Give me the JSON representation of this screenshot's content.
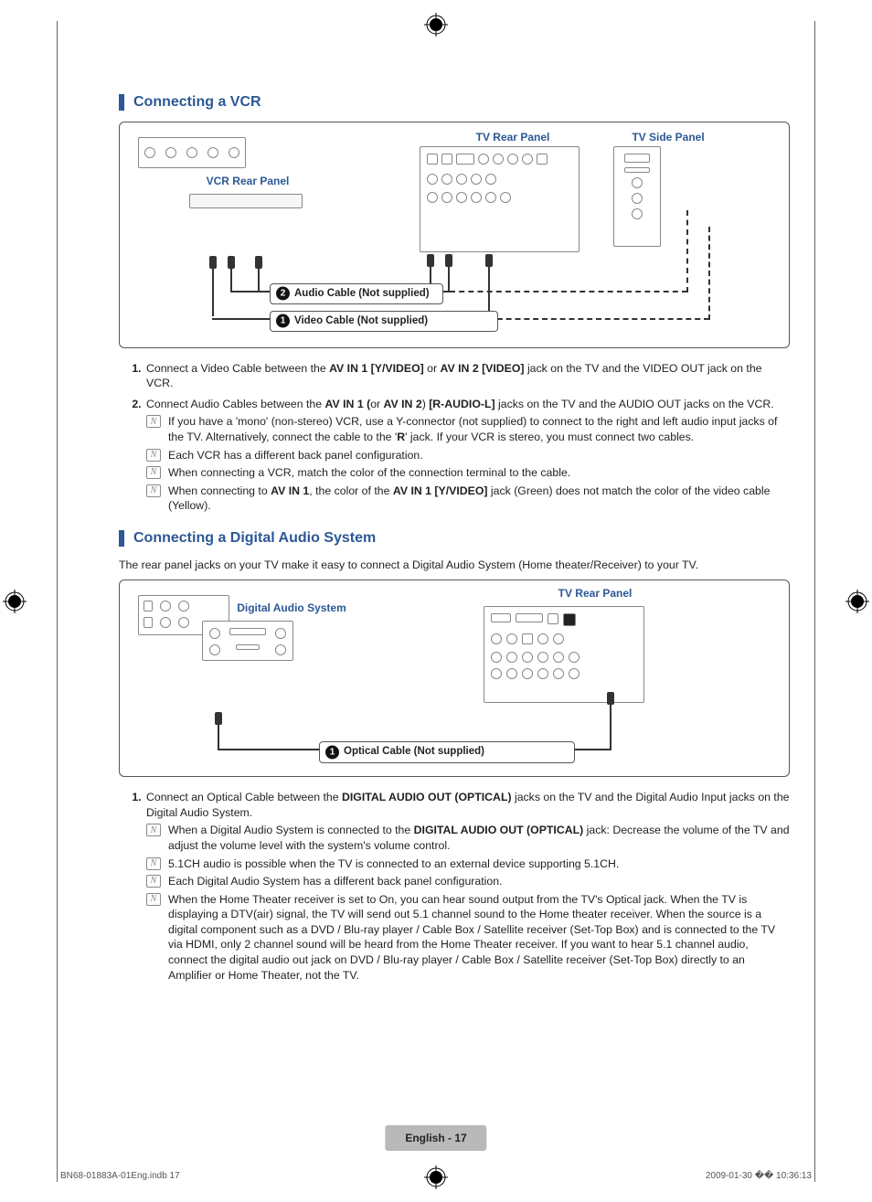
{
  "section1": {
    "title": "Connecting a VCR",
    "labels": {
      "vcr_rear": "VCR Rear Panel",
      "tv_rear": "TV Rear Panel",
      "tv_side": "TV Side Panel",
      "audio_cable": "Audio Cable (Not supplied)",
      "video_cable": "Video Cable (Not supplied)"
    },
    "steps": {
      "s1_prefix": "Connect a Video Cable between the ",
      "s1_b1": "AV IN 1 [Y/VIDEO]",
      "s1_mid": " or ",
      "s1_b2": "AV IN 2 [VIDEO]",
      "s1_suffix": " jack on the TV and the VIDEO OUT jack on the VCR.",
      "s2_prefix": "Connect Audio Cables between the ",
      "s2_b1": "AV IN 1 (",
      "s2_mid1": "or ",
      "s2_b2": "AV IN 2",
      "s2_mid2": ") ",
      "s2_b3": "[R-AUDIO-L]",
      "s2_suffix": " jacks on the TV and the AUDIO OUT jacks on the VCR.",
      "n1_a": "If you have a 'mono' (non-stereo) VCR, use a Y-connector (not supplied) to connect to the right and left audio input jacks of the TV. Alternatively, connect the cable to the '",
      "n1_b": "R",
      "n1_c": "' jack. If your VCR is stereo, you must connect two cables.",
      "n2": "Each VCR has a different back panel configuration.",
      "n3": "When connecting a VCR, match the color of the connection terminal to the cable.",
      "n4_a": "When connecting to ",
      "n4_b": "AV IN 1",
      "n4_c": ", the color of the ",
      "n4_d": "AV IN 1 [Y/VIDEO]",
      "n4_e": " jack (Green) does not match the color of the video cable (Yellow)."
    }
  },
  "section2": {
    "title": "Connecting a Digital Audio System",
    "intro": "The rear panel jacks on your TV make it easy to connect a Digital Audio System (Home theater/Receiver) to your TV.",
    "labels": {
      "das": "Digital Audio System",
      "tv_rear": "TV Rear Panel",
      "optical_cable": "Optical Cable (Not supplied)"
    },
    "steps": {
      "s1_prefix": "Connect an Optical Cable between the ",
      "s1_b1": "DIGITAL AUDIO OUT (OPTICAL)",
      "s1_suffix": " jacks on the TV and the Digital Audio Input jacks on the Digital Audio System.",
      "n1_a": "When a Digital Audio System is connected to the ",
      "n1_b": "DIGITAL AUDIO OUT (OPTICAL)",
      "n1_c": " jack: Decrease the volume of the TV and adjust the volume level with the system's volume control.",
      "n2": "5.1CH audio is possible when the TV is connected to an external device supporting 5.1CH.",
      "n3": "Each Digital Audio System has a different back panel configuration.",
      "n4": "When the Home Theater receiver is set to On, you can hear sound output from the TV's Optical jack. When the TV is displaying a DTV(air) signal, the TV will send out 5.1 channel sound to the Home theater receiver. When the source is a digital component such as a DVD / Blu-ray player / Cable Box / Satellite receiver (Set-Top Box) and is connected to the TV via HDMI, only 2 channel sound will be heard from the Home Theater receiver. If you want to hear 5.1 channel audio, connect the digital audio out jack on DVD / Blu-ray player / Cable Box / Satellite receiver (Set-Top Box) directly to an Amplifier or Home Theater, not the TV."
    }
  },
  "footer": {
    "page_label": "English - 17",
    "file": "BN68-01883A-01Eng.indb   17",
    "timestamp": "2009-01-30   �� 10:36:13"
  },
  "nums": {
    "one": "1",
    "two": "2"
  },
  "note_glyph": "N"
}
